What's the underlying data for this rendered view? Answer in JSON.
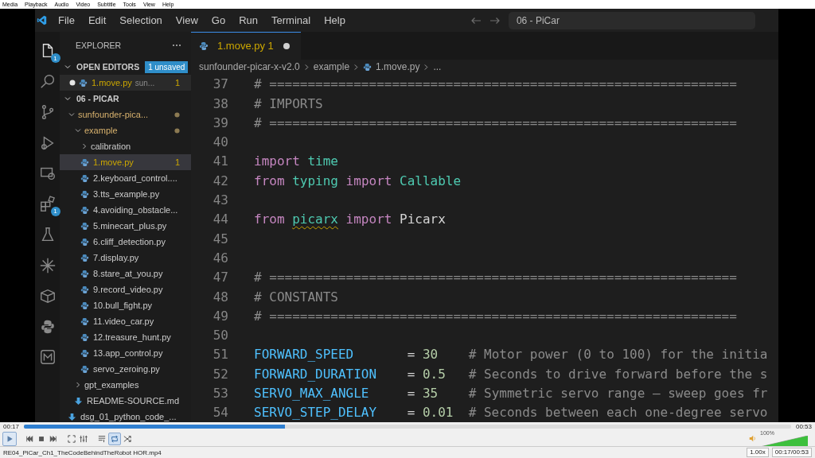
{
  "player": {
    "menu": [
      "Media",
      "Playback",
      "Audio",
      "Video",
      "Subtitle",
      "Tools",
      "View",
      "Help"
    ]
  },
  "window": {
    "menu": [
      "File",
      "Edit",
      "Selection",
      "View",
      "Go",
      "Run",
      "Terminal",
      "Help"
    ],
    "command_center": "06 - PiCar"
  },
  "activity_bar": [
    {
      "kind": "explorer",
      "selected": true,
      "badge": "1"
    },
    {
      "kind": "search",
      "selected": false
    },
    {
      "kind": "source-control",
      "selected": false
    },
    {
      "kind": "run-debug",
      "selected": false
    },
    {
      "kind": "remote",
      "selected": false
    },
    {
      "kind": "extensions",
      "selected": false,
      "badge": "1"
    },
    {
      "kind": "testing",
      "selected": false
    },
    {
      "kind": "sparkle",
      "selected": false
    },
    {
      "kind": "package",
      "selected": false
    },
    {
      "kind": "python",
      "selected": false
    },
    {
      "kind": "markdown",
      "selected": false
    }
  ],
  "sidebar": {
    "title": "EXPLORER",
    "open_editors": {
      "label": "OPEN EDITORS",
      "expanded": true,
      "badge": "1 unsaved",
      "items": [
        {
          "name": "1.move.py",
          "detail": "sun...",
          "problems": "1",
          "modified": true,
          "selected": false
        }
      ]
    },
    "workspace": {
      "label": "06 - PICAR",
      "expanded": true,
      "tree": [
        {
          "kind": "folder",
          "name": "sunfounder-pica...",
          "expanded": true,
          "modified": true,
          "selected": false,
          "children": [
            {
              "kind": "folder",
              "name": "example",
              "expanded": true,
              "modified": true,
              "selected": false,
              "children": [
                {
                  "kind": "folder",
                  "name": "calibration",
                  "expanded": false,
                  "selected": false
                },
                {
                  "kind": "python",
                  "name": "1.move.py",
                  "warning": true,
                  "problems": "1",
                  "selected": true
                },
                {
                  "kind": "python",
                  "name": "2.keyboard_control....",
                  "selected": false
                },
                {
                  "kind": "python",
                  "name": "3.tts_example.py",
                  "selected": false
                },
                {
                  "kind": "python",
                  "name": "4.avoiding_obstacle...",
                  "selected": false
                },
                {
                  "kind": "python",
                  "name": "5.minecart_plus.py",
                  "selected": false
                },
                {
                  "kind": "python",
                  "name": "6.cliff_detection.py",
                  "selected": false
                },
                {
                  "kind": "python",
                  "name": "7.display.py",
                  "selected": false
                },
                {
                  "kind": "python",
                  "name": "8.stare_at_you.py",
                  "selected": false
                },
                {
                  "kind": "python",
                  "name": "9.record_video.py",
                  "selected": false
                },
                {
                  "kind": "python",
                  "name": "10.bull_fight.py",
                  "selected": false
                },
                {
                  "kind": "python",
                  "name": "11.video_car.py",
                  "selected": false
                },
                {
                  "kind": "python",
                  "name": "12.treasure_hunt.py",
                  "selected": false
                },
                {
                  "kind": "python",
                  "name": "13.app_control.py",
                  "selected": false
                },
                {
                  "kind": "python",
                  "name": "servo_zeroing.py",
                  "selected": false
                }
              ]
            },
            {
              "kind": "folder",
              "name": "gpt_examples",
              "expanded": false,
              "selected": false
            },
            {
              "kind": "markdown",
              "name": "README-SOURCE.md",
              "selected": false
            }
          ]
        },
        {
          "kind": "markdown",
          "name": "dsg_01_python_code_...",
          "selected": false
        }
      ]
    }
  },
  "tabs": [
    {
      "label": "1.move.py",
      "problems": "1",
      "modified": true,
      "selected": true
    }
  ],
  "breadcrumb": [
    {
      "kind": "folder",
      "text": "sunfounder-picar-x-v2.0"
    },
    {
      "kind": "folder",
      "text": "example"
    },
    {
      "kind": "python",
      "text": "1.move.py"
    },
    {
      "kind": "more",
      "text": "..."
    }
  ],
  "code": [
    {
      "number": "37",
      "tokens": [
        {
          "kind": "comment",
          "text": "# ============================================================="
        }
      ]
    },
    {
      "number": "38",
      "tokens": [
        {
          "kind": "comment",
          "text": "# IMPORTS"
        }
      ]
    },
    {
      "number": "39",
      "tokens": [
        {
          "kind": "comment",
          "text": "# ============================================================="
        }
      ]
    },
    {
      "number": "40"
    },
    {
      "number": "41",
      "tokens": [
        {
          "kind": "keyword",
          "text": "import "
        },
        {
          "kind": "module",
          "text": "time"
        }
      ]
    },
    {
      "number": "42",
      "tokens": [
        {
          "kind": "keyword",
          "text": "from "
        },
        {
          "kind": "module",
          "text": "typing "
        },
        {
          "kind": "keyword",
          "text": "import "
        },
        {
          "kind": "module",
          "text": "Callable"
        }
      ]
    },
    {
      "number": "43"
    },
    {
      "number": "44",
      "tokens": [
        {
          "kind": "keyword",
          "text": "from "
        },
        {
          "kind": "module",
          "text": "picarx",
          "warning": true
        },
        {
          "kind": "keyword",
          "text": " import"
        },
        {
          "kind": "plain",
          "text": " Picarx"
        }
      ]
    },
    {
      "number": "45"
    },
    {
      "number": "46"
    },
    {
      "number": "47",
      "tokens": [
        {
          "kind": "comment",
          "text": "# ============================================================="
        }
      ]
    },
    {
      "number": "48",
      "tokens": [
        {
          "kind": "comment",
          "text": "# CONSTANTS"
        }
      ]
    },
    {
      "number": "49",
      "tokens": [
        {
          "kind": "comment",
          "text": "# ============================================================="
        }
      ]
    },
    {
      "number": "50"
    },
    {
      "number": "51",
      "tokens": [
        {
          "kind": "constant",
          "text": "FORWARD_SPEED"
        },
        {
          "kind": "plain",
          "text": "       = "
        },
        {
          "kind": "number",
          "text": "30"
        },
        {
          "kind": "comment",
          "text": "    # Motor power (0 to 100) for the initia"
        }
      ]
    },
    {
      "number": "52",
      "tokens": [
        {
          "kind": "constant",
          "text": "FORWARD_DURATION"
        },
        {
          "kind": "plain",
          "text": "    = "
        },
        {
          "kind": "number",
          "text": "0.5"
        },
        {
          "kind": "comment",
          "text": "   # Seconds to drive forward before the s"
        }
      ]
    },
    {
      "number": "53",
      "tokens": [
        {
          "kind": "constant",
          "text": "SERVO_MAX_ANGLE"
        },
        {
          "kind": "plain",
          "text": "     = "
        },
        {
          "kind": "number",
          "text": "35"
        },
        {
          "kind": "comment",
          "text": "    # Symmetric servo range – sweep goes fr"
        }
      ]
    },
    {
      "number": "54",
      "tokens": [
        {
          "kind": "constant",
          "text": "SERVO_STEP_DELAY"
        },
        {
          "kind": "plain",
          "text": "    = "
        },
        {
          "kind": "number",
          "text": "0.01"
        },
        {
          "kind": "comment",
          "text": "  # Seconds between each one-degree servo"
        }
      ]
    }
  ],
  "playback": {
    "elapsed": "00:17",
    "total": "00:53",
    "level": 0.34,
    "controls": [
      {
        "kind": "play"
      },
      {
        "kind": "previous"
      },
      {
        "kind": "stop"
      },
      {
        "kind": "next"
      },
      {
        "kind": "fullscreen"
      },
      {
        "kind": "settings"
      },
      {
        "kind": "playlist"
      },
      {
        "kind": "loop",
        "on": true
      },
      {
        "kind": "random",
        "on": false
      }
    ],
    "file": "RE04_PiCar_Ch1_TheCodeBehindTheRobot HOR.mp4",
    "volume": {
      "label": "100%",
      "level": 1
    },
    "speed": "1.00x",
    "time": "00:17/00:53"
  }
}
